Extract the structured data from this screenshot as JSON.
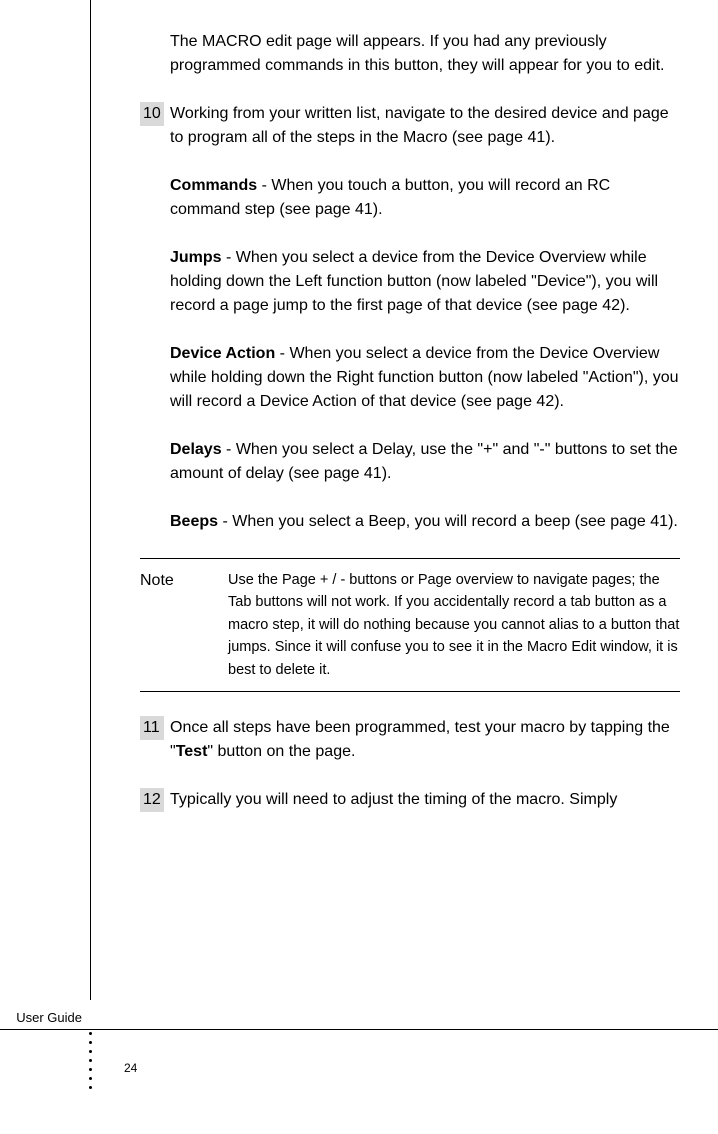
{
  "intro": "The MACRO edit page will appears. If you had any previously programmed commands in this button, they will appear for you to edit.",
  "steps": {
    "s10": {
      "num": "10",
      "text": "Working from your written list, navigate to the desired device and page to program all of the steps in the Macro (see page 41)."
    },
    "s11": {
      "num": "11",
      "text_before": "Once all steps have been programmed, test your macro by tapping the \"",
      "bold": "Test",
      "text_after": "\" button on the page."
    },
    "s12": {
      "num": "12",
      "text": "Typically you will need to adjust the timing of the macro. Simply"
    }
  },
  "subs": {
    "commands": {
      "label": "Commands",
      "text": " - When you touch a button, you will record an RC command step (see page 41)."
    },
    "jumps": {
      "label": "Jumps",
      "text": " - When you select a device from the Device Overview while holding down the Left function button (now labeled \"Device\"), you will record a page jump to the first page of that device (see page 42)."
    },
    "device_action": {
      "label": "Device Action",
      "text": " - When you select a device from the Device Overview while holding down the Right function button (now labeled \"Action\"), you will record a Device Action of that device (see page 42)."
    },
    "delays": {
      "label": "Delays",
      "text": " - When you select a Delay, use the \"+\" and \"-\" buttons to set the amount of delay (see page 41)."
    },
    "beeps": {
      "label": "Beeps",
      "text": " - When you select a Beep, you will record a beep (see page 41)."
    }
  },
  "note": {
    "label": "Note",
    "text": "Use the Page + / - buttons or Page overview to navigate pages; the Tab buttons will not work. If you accidentally record a tab button as a macro step, it will do nothing because you cannot alias to a button that jumps. Since it will confuse you to see it in the Macro Edit window,  it is best to delete it."
  },
  "footer": {
    "guide_label": "User Guide",
    "page_number": "24"
  }
}
